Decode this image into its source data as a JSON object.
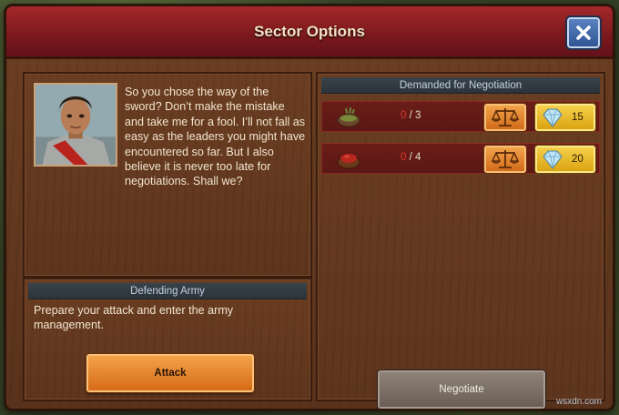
{
  "dialog": {
    "title": "Sector Options",
    "close_icon": "close-x-icon"
  },
  "leader": {
    "portrait_icon": "roman-leader-portrait",
    "message": "So you chose the way of the sword? Don’t make the mistake and take me for a fool. I’ll not fall as easy as the leaders you might have encountered so far. But I also believe it is never too late for negotiations. Shall we?"
  },
  "defending": {
    "header": "Defending Army",
    "text": "Prepare your attack and enter the army management.",
    "attack_label": "Attack"
  },
  "negotiation": {
    "header": "Demanded for Negotiation",
    "items": [
      {
        "good_icon": "herbs-bowl-icon",
        "have": "0",
        "need": "/ 3",
        "trade_icon": "scales-icon",
        "gem_icon": "diamond-icon",
        "cost": "15"
      },
      {
        "good_icon": "red-spice-bowl-icon",
        "have": "0",
        "need": "/ 4",
        "trade_icon": "scales-icon",
        "gem_icon": "diamond-icon",
        "cost": "20"
      }
    ],
    "negotiate_label": "Negotiate"
  },
  "watermark": "wsxdn.com",
  "colors": {
    "title_bar": "#8a1f22",
    "attack_button": "#e98a2e",
    "gem_button": "#f0c43a",
    "deficit_count": "#e0362a"
  }
}
